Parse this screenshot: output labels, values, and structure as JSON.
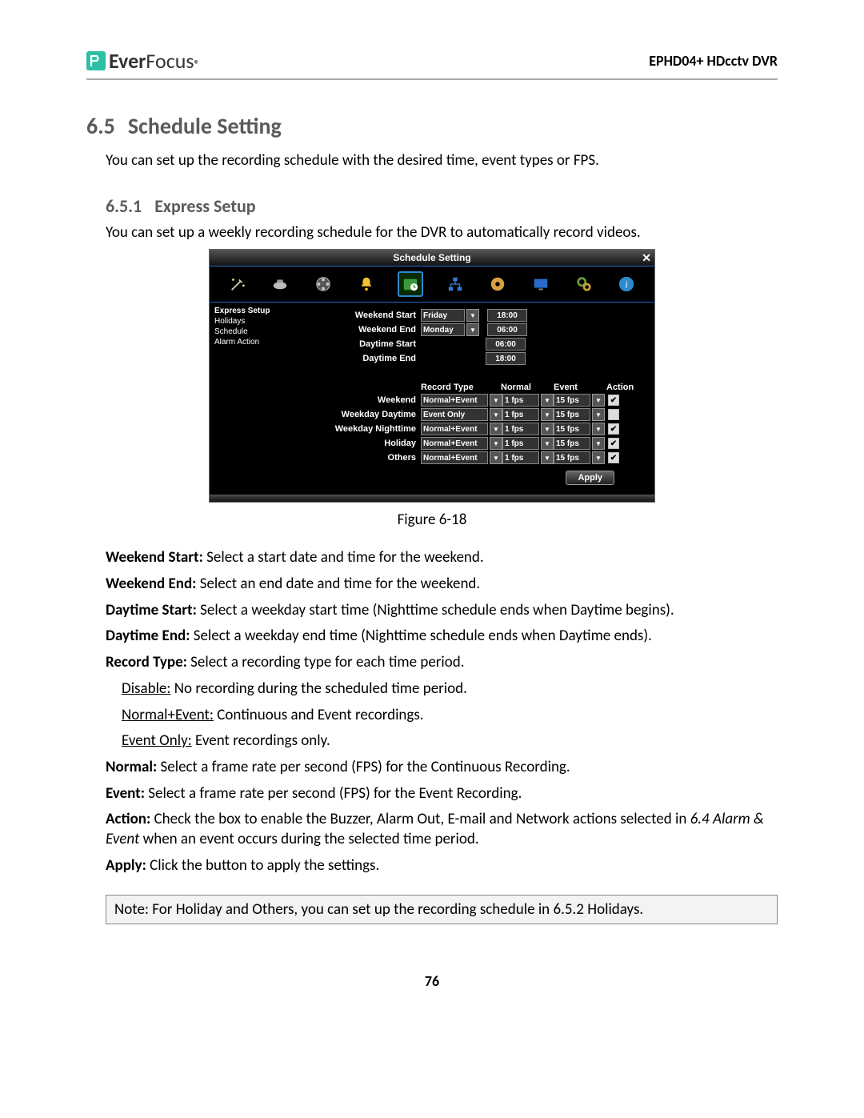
{
  "header": {
    "brand_bold": "Ever",
    "brand_rest": "Focus",
    "brand_tm": "®",
    "product": "EPHD04+  HDcctv DVR"
  },
  "section": {
    "num": "6.5",
    "title": "Schedule Setting",
    "intro": "You can set up the recording schedule with the desired time, event types or FPS."
  },
  "subsection": {
    "num": "6.5.1",
    "title": "Express Setup",
    "intro": "You can set up a weekly recording schedule for the DVR to automatically record videos."
  },
  "gui": {
    "title": "Schedule Setting",
    "icons": [
      "wand",
      "camera",
      "reel",
      "bell",
      "schedule",
      "network",
      "disc",
      "monitor",
      "gear",
      "info"
    ],
    "active_icon_index": 4,
    "sidebar": [
      "Express Setup",
      "Holidays",
      "Schedule",
      "Alarm Action"
    ],
    "sidebar_selected": 0,
    "time_rows": [
      {
        "label": "Weekend Start",
        "day": "Friday",
        "time": "18:00"
      },
      {
        "label": "Weekend End",
        "day": "Monday",
        "time": "06:00"
      },
      {
        "label": "Daytime Start",
        "day": null,
        "time": "06:00"
      },
      {
        "label": "Daytime End",
        "day": null,
        "time": "18:00"
      }
    ],
    "headers": {
      "rec": "Record Type",
      "normal": "Normal",
      "event": "Event",
      "action": "Action"
    },
    "rec_rows": [
      {
        "label": "Weekend",
        "rec": "Normal+Event",
        "normal": "1 fps",
        "event": "15 fps",
        "action": true
      },
      {
        "label": "Weekday Daytime",
        "rec": "Event Only",
        "normal": "1 fps",
        "event": "15 fps",
        "action": false
      },
      {
        "label": "Weekday Nighttime",
        "rec": "Normal+Event",
        "normal": "1 fps",
        "event": "15 fps",
        "action": true
      },
      {
        "label": "Holiday",
        "rec": "Normal+Event",
        "normal": "1 fps",
        "event": "15 fps",
        "action": true
      },
      {
        "label": "Others",
        "rec": "Normal+Event",
        "normal": "1 fps",
        "event": "15 fps",
        "action": true
      }
    ],
    "apply_label": "Apply"
  },
  "figure_caption": "Figure 6-18",
  "definitions": [
    {
      "term": "Weekend Start:",
      "text": " Select a start date and time for the weekend."
    },
    {
      "term": "Weekend End:",
      "text": " Select an end date and time for the weekend."
    },
    {
      "term": "Daytime Start:",
      "text": " Select a weekday start time (Nighttime schedule ends when Daytime begins)."
    },
    {
      "term": "Daytime End:",
      "text": " Select a weekday end time (Nighttime schedule ends when Daytime ends)."
    },
    {
      "term": "Record Type:",
      "text": " Select a recording type for each time period."
    }
  ],
  "record_type_sub": [
    {
      "u": "Disable:",
      "text": " No recording during the scheduled time period."
    },
    {
      "u": "Normal+Event:",
      "text": " Continuous and Event recordings."
    },
    {
      "u": "Event Only:",
      "text": " Event recordings only."
    }
  ],
  "definitions2": [
    {
      "term": "Normal:",
      "text": " Select a frame rate per second (FPS) for the Continuous Recording."
    },
    {
      "term": "Event:",
      "text": " Select a frame rate per second (FPS) for the Event Recording."
    },
    {
      "term": "Action:",
      "text": " Check the box to enable the Buzzer, Alarm Out, E-mail and Network actions selected in ",
      "italic": "6.4 Alarm & Event",
      "text2": " when an event occurs during the selected time period."
    },
    {
      "term": "Apply:",
      "text": " Click the button to apply the settings."
    }
  ],
  "note": {
    "prefix": "Note:",
    "mid1": " For ",
    "b1": "Holiday",
    "mid2": " and ",
    "b2": "Others",
    "mid3": ", you can set up the recording schedule in ",
    "italic": "6.5.2 Holidays",
    "tail": "."
  },
  "page_number": "76"
}
